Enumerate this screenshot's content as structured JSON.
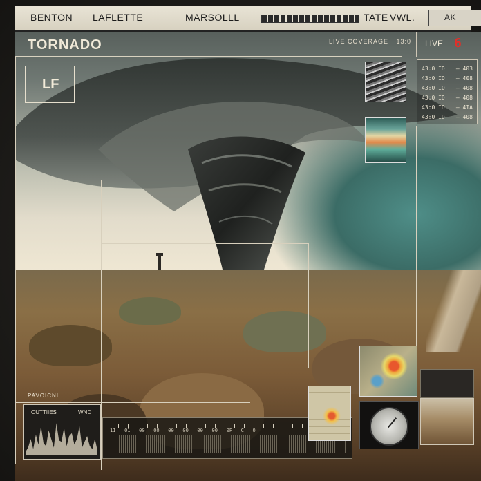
{
  "counties": [
    {
      "name": "BENTON"
    },
    {
      "name": "LAFLETTE"
    },
    {
      "name": "MARSOLLL"
    },
    {
      "name": "TATE"
    },
    {
      "name": "VWL."
    },
    {
      "name": "AK"
    }
  ],
  "header": {
    "title": "TORNADO",
    "coverage": "LIVE COVERAGE",
    "coverage_suffix": "13:0"
  },
  "live": {
    "label": "LIVE",
    "number": "6"
  },
  "logo": {
    "text": "LF"
  },
  "readout_rows": [
    {
      "left": "43:0 ID",
      "right": "— 403"
    },
    {
      "left": "43:0 ID",
      "right": "— 408"
    },
    {
      "left": "43:0 IO",
      "right": "— 408"
    },
    {
      "left": "43:0 ID",
      "right": "— 408"
    },
    {
      "left": "43:0 ID",
      "right": "— 4IA"
    },
    {
      "left": "43:0 ID",
      "right": "— 408"
    }
  ],
  "bottom": {
    "label": "PAVOICNL",
    "wave_left": "OUTTIIES",
    "wave_right": "WND",
    "ruler_ticks": "11   01   00   00   00   00   00   00   0F   C   0"
  },
  "waveform": [
    4,
    10,
    22,
    8,
    28,
    14,
    40,
    16,
    12,
    34,
    22,
    10,
    44,
    20,
    18,
    38,
    12,
    26,
    30,
    14,
    22,
    40,
    10,
    18,
    26,
    12,
    8,
    22,
    6
  ],
  "colors": {
    "accent_live": "#e0302a",
    "overlay_lines": "#d8d0bd",
    "tornado_sky": "#58605c",
    "green_sky": "#3b6c66"
  },
  "icons": {
    "gauge": "compass-gauge-icon",
    "tower": "tower-icon"
  }
}
